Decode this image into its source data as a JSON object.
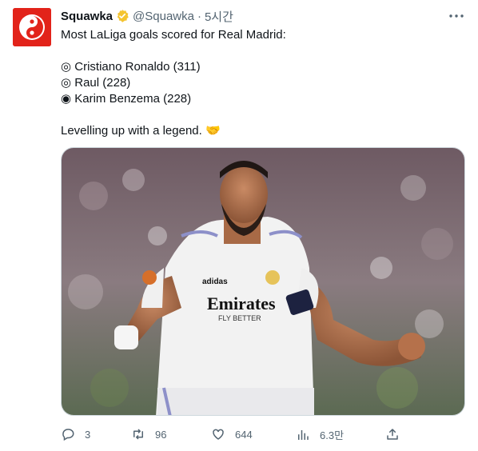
{
  "tweet": {
    "author_name": "Squawka",
    "handle": "@Squawka",
    "separator": "·",
    "time": "5시간",
    "lines": [
      "Most LaLiga goals scored for Real Madrid:",
      "",
      "◎ Cristiano Ronaldo (311)",
      "◎ Raul (228)",
      "◉ Karim Benzema (228)",
      "",
      "Levelling up with a legend. 🤝"
    ],
    "image_shirt_sponsor": "Emirates",
    "image_shirt_sponsor_sub": "FLY BETTER",
    "image_shirt_brand": "adidas"
  },
  "actions": {
    "replies": "3",
    "retweets": "96",
    "likes": "644",
    "views": "6.3만"
  },
  "icons": [
    "verified-badge-icon",
    "more-icon",
    "reply-icon",
    "retweet-icon",
    "like-icon",
    "views-icon",
    "share-icon"
  ],
  "colors": {
    "verified": "#f4c430",
    "muted": "#536471",
    "avatar": "#e2231a"
  }
}
